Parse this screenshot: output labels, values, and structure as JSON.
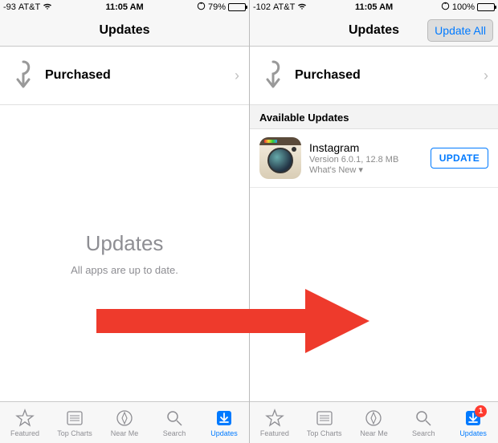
{
  "left": {
    "status": {
      "signal": "-93",
      "carrier": "AT&T",
      "time": "11:05 AM",
      "battery_pct": "79%",
      "battery_fill": 79
    },
    "nav": {
      "title": "Updates"
    },
    "purchased_label": "Purchased",
    "empty": {
      "title": "Updates",
      "sub": "All apps are up to date."
    }
  },
  "right": {
    "status": {
      "signal": "-102",
      "carrier": "AT&T",
      "time": "11:05 AM",
      "battery_pct": "100%",
      "battery_fill": 100
    },
    "nav": {
      "title": "Updates",
      "update_all": "Update All"
    },
    "purchased_label": "Purchased",
    "section_header": "Available Updates",
    "update": {
      "name": "Instagram",
      "meta": "Version 6.0.1, 12.8 MB",
      "whatsnew": "What's New ▾",
      "button": "UPDATE"
    },
    "badge": "1"
  },
  "tabs": [
    "Featured",
    "Top Charts",
    "Near Me",
    "Search",
    "Updates"
  ],
  "icons": {
    "chevron": "›"
  }
}
